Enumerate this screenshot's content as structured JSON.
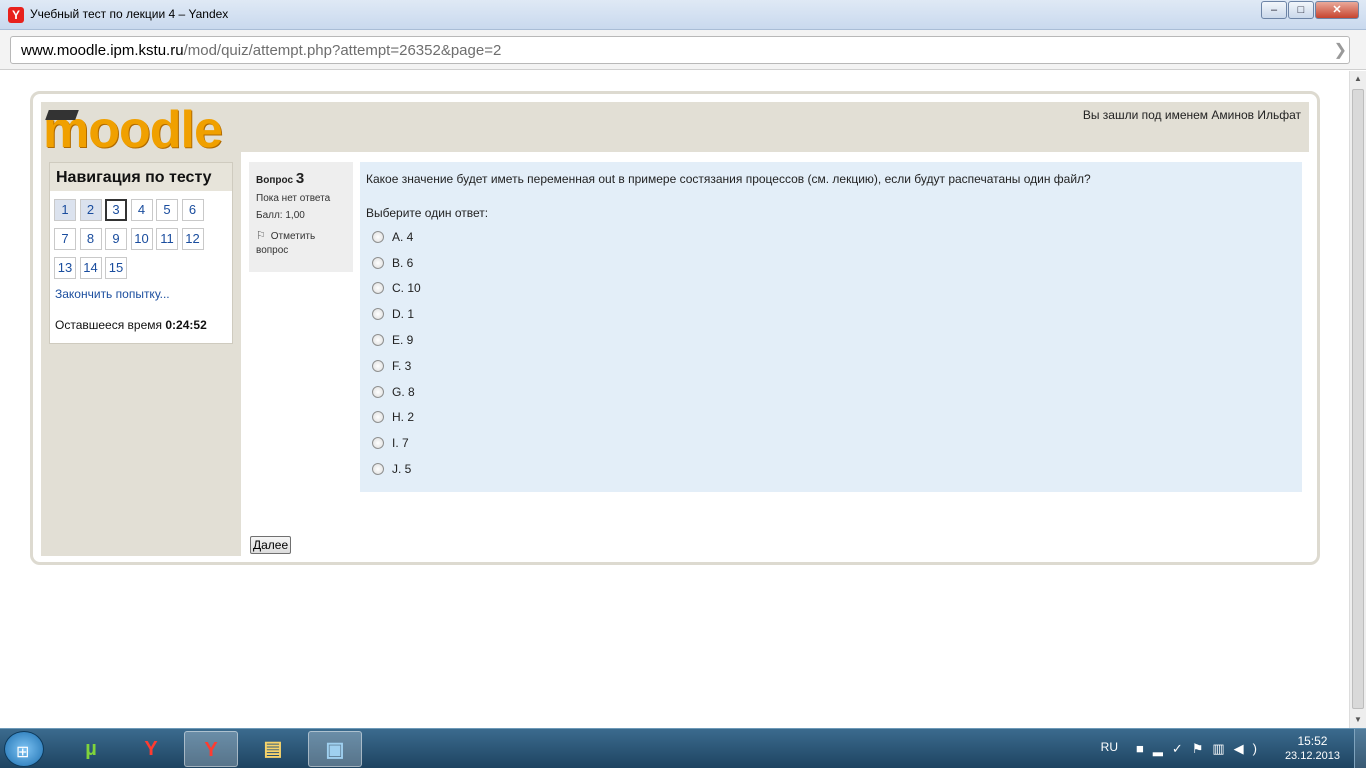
{
  "window": {
    "title": "Учебный тест по лекции 4 – Yandex",
    "minimize": "‒",
    "maximize": "□",
    "close": "✕"
  },
  "address": {
    "host": "www.moodle.ipm.kstu.ru",
    "path": "/mod/quiz/attempt.php?attempt=26352&page=2"
  },
  "header": {
    "logo": "moodle",
    "login_info": "Вы зашли под именем Аминов Ильфат"
  },
  "navigation": {
    "title": "Навигация по тесту",
    "questions": [
      {
        "label": "1",
        "state": "answered"
      },
      {
        "label": "2",
        "state": "answered"
      },
      {
        "label": "3",
        "state": "current"
      },
      {
        "label": "4",
        "state": "normal"
      },
      {
        "label": "5",
        "state": "normal"
      },
      {
        "label": "6",
        "state": "normal"
      },
      {
        "label": "7",
        "state": "normal"
      },
      {
        "label": "8",
        "state": "normal"
      },
      {
        "label": "9",
        "state": "normal"
      },
      {
        "label": "10",
        "state": "normal"
      },
      {
        "label": "11",
        "state": "normal"
      },
      {
        "label": "12",
        "state": "normal"
      },
      {
        "label": "13",
        "state": "normal"
      },
      {
        "label": "14",
        "state": "normal"
      },
      {
        "label": "15",
        "state": "normal"
      }
    ],
    "finish_link": "Закончить попытку...",
    "time_label": "Оставшееся время",
    "time_value": "0:24:52"
  },
  "question": {
    "label": "Вопрос",
    "number": "3",
    "status": "Пока нет ответа",
    "score": "Балл: 1,00",
    "flag_label": "Отметить вопрос",
    "text": "Какое значение будет иметь переменная out в примере состязания процессов (см. лекцию), если будут распечатаны один файл?",
    "prompt": "Выберите один ответ:",
    "answers": [
      "A. 4",
      "B. 6",
      "C. 10",
      "D. 1",
      "E. 9",
      "F. 3",
      "G. 8",
      "H. 2",
      "I. 7",
      "J. 5"
    ]
  },
  "next_button": "Далее",
  "taskbar": {
    "language": "RU",
    "time": "15:52",
    "date": "23.12.2013"
  }
}
